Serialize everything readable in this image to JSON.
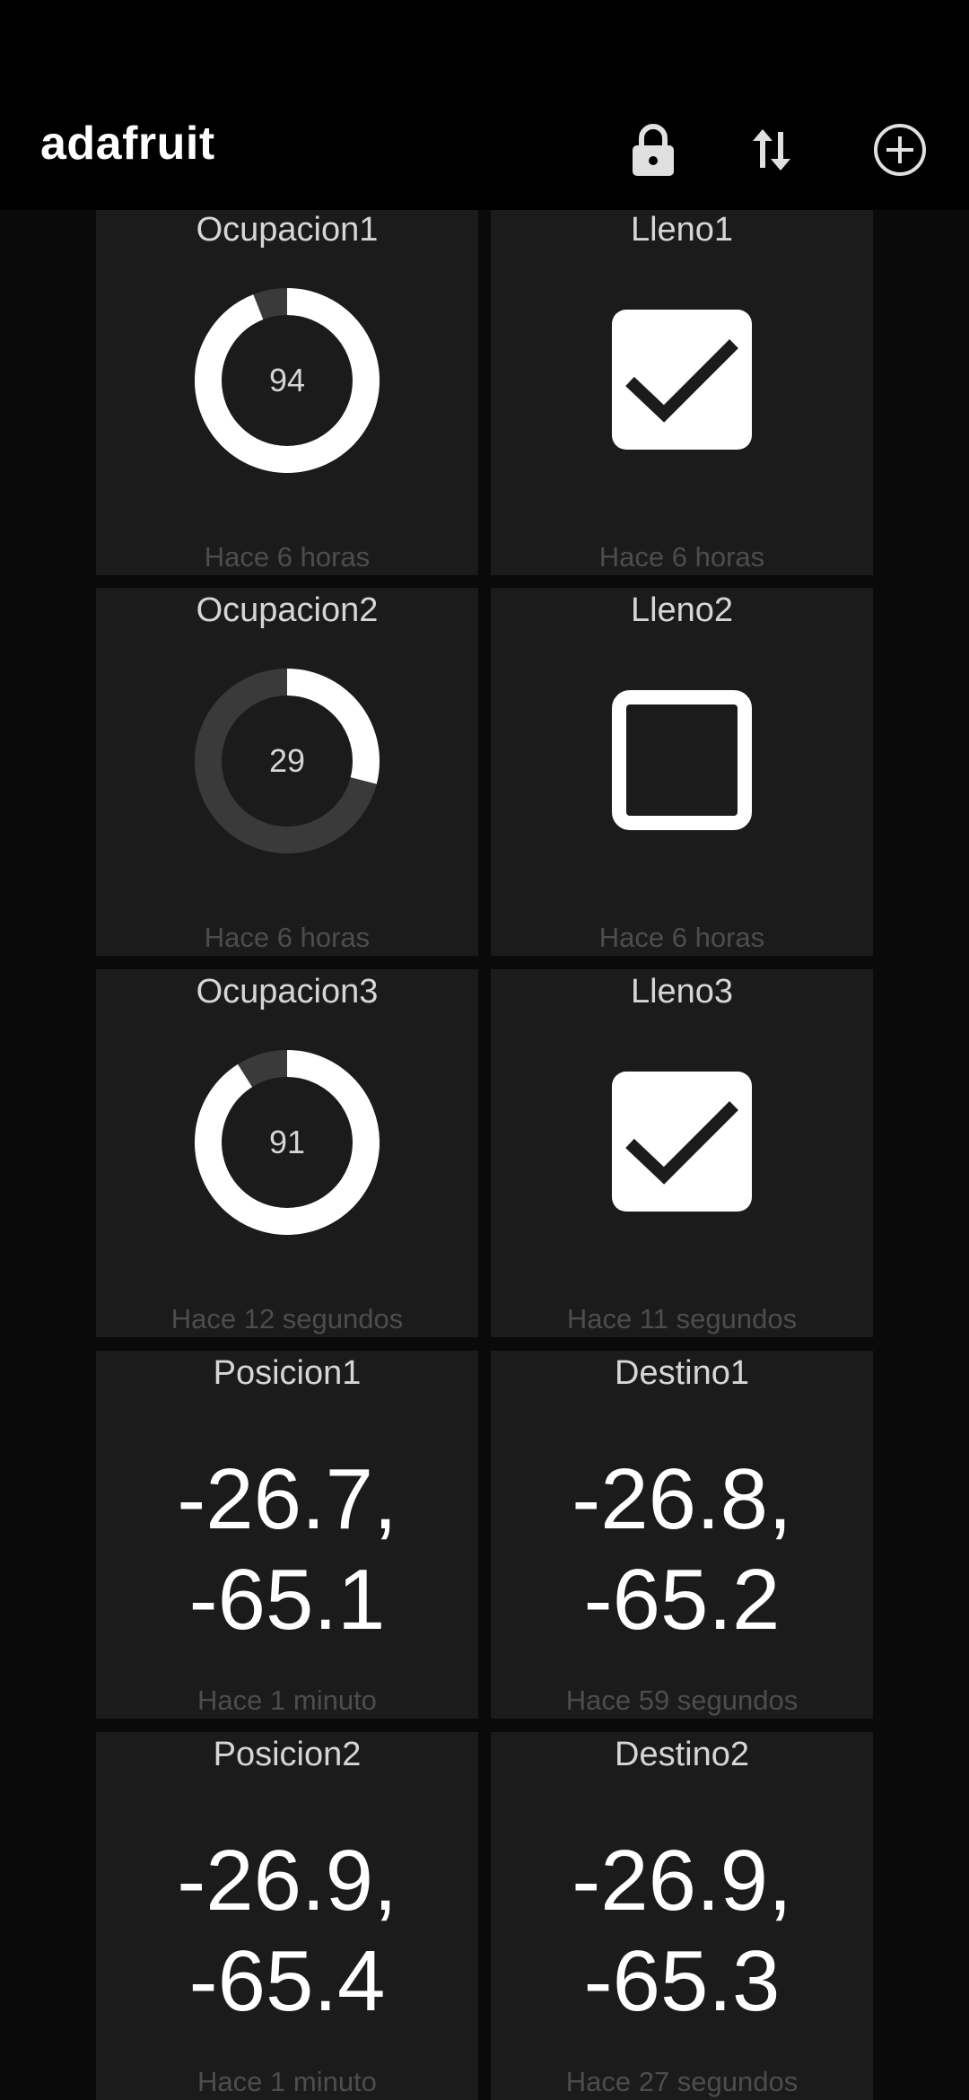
{
  "app": {
    "title": "adafruit",
    "actions": [
      "lock-icon",
      "swap-vertical-icon",
      "add-circle-icon"
    ]
  },
  "colors": {
    "background": "#0a0a0a",
    "card": "#1b1b1b",
    "gauge_fill": "#ffffff",
    "gauge_track": "#3a3a3a",
    "timestamp": "#4d4d4d"
  },
  "cards": {
    "ocupacion1": {
      "title": "Ocupacion1",
      "value": "94",
      "percent": 94,
      "time": "Hace 6 horas"
    },
    "lleno1": {
      "title": "Lleno1",
      "checked": true,
      "time": "Hace 6 horas"
    },
    "ocupacion2": {
      "title": "Ocupacion2",
      "value": "29",
      "percent": 29,
      "time": "Hace 6 horas"
    },
    "lleno2": {
      "title": "Lleno2",
      "checked": false,
      "time": "Hace 6 horas"
    },
    "ocupacion3": {
      "title": "Ocupacion3",
      "value": "91",
      "percent": 91,
      "time": "Hace 12 segundos"
    },
    "lleno3": {
      "title": "Lleno3",
      "checked": true,
      "time": "Hace 11 segundos"
    },
    "posicion1": {
      "title": "Posicion1",
      "line1": "-26.7,",
      "line2": "-65.1",
      "time": "Hace 1 minuto"
    },
    "destino1": {
      "title": "Destino1",
      "line1": "-26.8,",
      "line2": "-65.2",
      "time": "Hace 59 segundos"
    },
    "posicion2": {
      "title": "Posicion2",
      "line1": "-26.9,",
      "line2": "-65.4",
      "time": "Hace 1 minuto"
    },
    "destino2": {
      "title": "Destino2",
      "line1": "-26.9,",
      "line2": "-65.3",
      "time": "Hace 27 segundos"
    }
  }
}
